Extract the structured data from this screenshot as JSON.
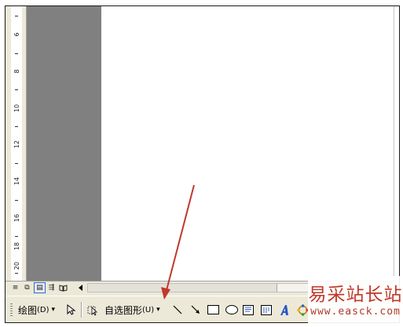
{
  "ruler": {
    "numbers": [
      "6",
      "8",
      "10",
      "12",
      "14",
      "16",
      "18",
      "20"
    ]
  },
  "view_buttons": [
    {
      "name": "normal-view",
      "glyph": "≡"
    },
    {
      "name": "web-view",
      "glyph": "⧉"
    },
    {
      "name": "print-view",
      "glyph": "▤"
    },
    {
      "name": "outline-view",
      "glyph": "⇶"
    },
    {
      "name": "reading-view",
      "glyph": "📖"
    }
  ],
  "toolbar": {
    "draw_label": "绘图",
    "draw_shortcut": "(D)",
    "autoshapes_label": "自选图形",
    "autoshapes_shortcut": "(U)",
    "dropdown_glyph": "▾"
  },
  "watermark": {
    "cn": "易采站长站",
    "url": "www.easck.com"
  },
  "colors": {
    "annotation_arrow": "#c0392b",
    "gray_area": "#808080",
    "toolbar_bg": "#ece9d8"
  }
}
